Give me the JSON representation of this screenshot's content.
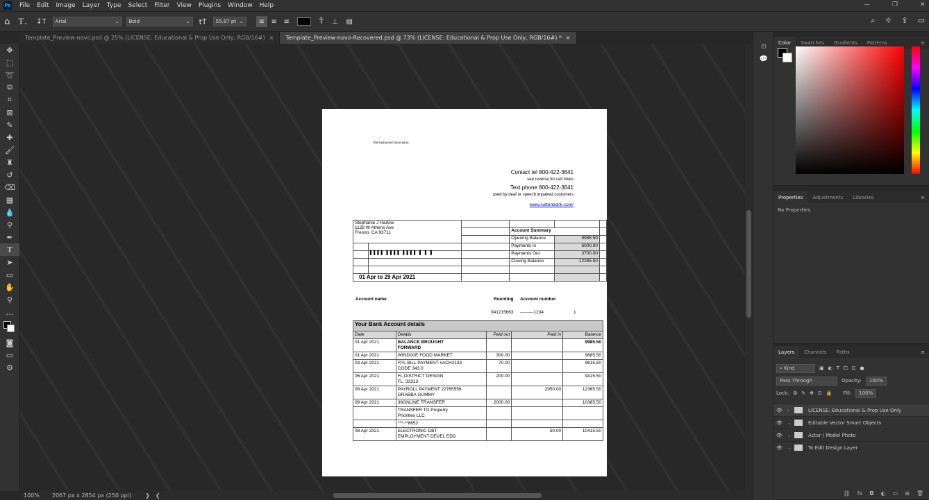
{
  "menubar": {
    "logo": "Ps",
    "items": [
      "File",
      "Edit",
      "Image",
      "Layer",
      "Type",
      "Select",
      "Filter",
      "View",
      "Plugins",
      "Window",
      "Help"
    ]
  },
  "options": {
    "font_family": "Arial",
    "font_style": "Bold",
    "font_size": "55.87 pt"
  },
  "tabs": [
    {
      "label": "Template_Preview-novo.psd @ 25% (LICENSE: Educational & Prop Use Only, RGB/16#)",
      "close": "×"
    },
    {
      "label": "Template_Preview-novo-Recovered.psd @ 73% (LICENSE: Educational & Prop Use Only, RGB/16#) *",
      "close": "×"
    }
  ],
  "status": {
    "zoom": "100%",
    "dims": "2067 px x 2854 px (250 ppi)"
  },
  "panels": {
    "color_tabs": [
      "Color",
      "Swatches",
      "Gradients",
      "Patterns"
    ],
    "properties_tabs": [
      "Properties",
      "Adjustments",
      "Libraries"
    ],
    "no_properties": "No Properties",
    "layers_tabs": [
      "Layers",
      "Channels",
      "Paths"
    ],
    "kind": "Kind",
    "blend": "Pass Through",
    "opacity_label": "Opacity:",
    "opacity": "100%",
    "lock_label": "Lock:",
    "fill_label": "Fill:",
    "fill": "100%",
    "layers": [
      "LICENSE: Educational & Prop Use Only",
      "Editable Vector Smart Objects",
      "Actor / Model Photo",
      "To Edit Design Layer"
    ]
  },
  "document": {
    "tagline": "Old-fashioned Innovation",
    "contact_tel": "Contact tel 800-422-3641",
    "see_reverse": "see reverse for call times",
    "text_phone": "Text phone 800-422-3641",
    "deaf_line": "used by deaf or speech impaired customers",
    "website": "www.suttonbank.com/",
    "name": "Stephanie J Harlow",
    "addr1": "1128 W Athens Ave",
    "addr2": "Fresno, CA 93711",
    "barcode": "▌▌▌▌ ▌▌▌▌ ▌▌▌▌ ▌ ▌ ▌",
    "period": "01 Apr to 29 Apr 2021",
    "summary_title": "Account Summary",
    "summary": [
      {
        "label": "Opening Balance",
        "value": "9985.50"
      },
      {
        "label": "Payments in",
        "value": "6000.00"
      },
      {
        "label": "Payments Out",
        "value": "3700.00"
      },
      {
        "label": "Closing Balance",
        "value": "12285.50"
      }
    ],
    "acct_name_label": "Account name",
    "routing_label": "Rounting",
    "acct_number_label": "Account number",
    "routing": "041215663",
    "acct_number": "---------1234",
    "acct_extra": "1",
    "tx_title": "Your Bank Account details",
    "tx_headers": [
      "Date",
      "Details",
      "Paid out",
      "Paid in",
      "Balance"
    ],
    "tx_rows": [
      {
        "date": "01 Apr 2021",
        "details": "BALANCE BROUGHT",
        "details2": "FORWARD",
        "out": "",
        "in": "",
        "bal": "9985.50",
        "bold": true
      },
      {
        "date": "01 Apr 2021",
        "details": "WINDIXIE FOOD MARKET",
        "details2": "",
        "out": "300.00",
        "in": "",
        "bal": "9685.50"
      },
      {
        "date": "03 Apr 2021",
        "details": "FPL BILL PAYMENT #ACH2133",
        "details2": "CODE 343.0",
        "out": "70.00",
        "in": "",
        "bal": "9615.50"
      },
      {
        "date": "06 Apr 2021",
        "details": "FL DISTRICT DESIGN",
        "details2": "FL. 33313",
        "out": "200.00",
        "in": "",
        "bal": "9415.50"
      },
      {
        "date": "06 Apr 2021",
        "details": "PAYROLL PAYMENT 22765556",
        "details2": "GRABBA GUMMY",
        "out": "",
        "in": "2950.00",
        "bal": "12365.50"
      },
      {
        "date": "08 Apr 2021",
        "details": "36ONLINE TRANSFER",
        "details2": "",
        "out": "2000.00",
        "in": "",
        "bal": "10365.50"
      },
      {
        "date": "",
        "details": "TRANSFER TO Property",
        "details2": "Priorities LLC",
        "out": "",
        "in": "",
        "bal": ""
      },
      {
        "date": "",
        "details": "***-**8652",
        "details2": "",
        "out": "",
        "in": "",
        "bal": ""
      },
      {
        "date": "08 Apr 2021",
        "details": "ELECTRONIC DBT",
        "details2": "EMPLOYMENT DEVEL EDD",
        "out": "",
        "in": "50.00",
        "bal": "10415.50"
      }
    ]
  }
}
